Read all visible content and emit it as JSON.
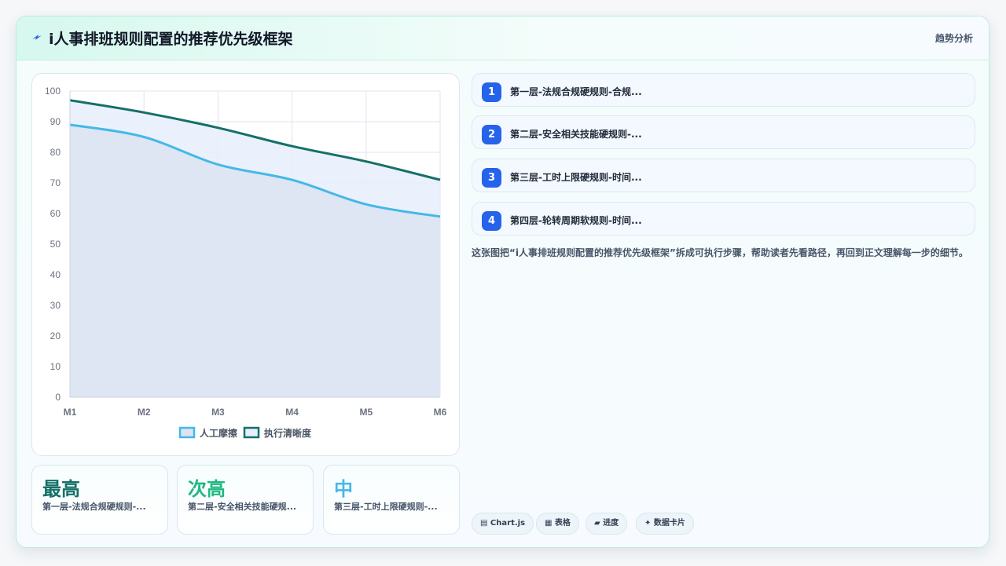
{
  "header": {
    "icon": "lightning-icon",
    "title": "i人事排班规则配置的推荐优先级框架",
    "right_label": "趋势分析"
  },
  "chart_data": {
    "type": "area",
    "title": "",
    "xlabel": "",
    "ylabel": "",
    "categories": [
      "M1",
      "M2",
      "M3",
      "M4",
      "M5",
      "M6"
    ],
    "ylim": [
      0,
      100
    ],
    "yticks": [
      0,
      10,
      20,
      30,
      40,
      50,
      60,
      70,
      80,
      90,
      100
    ],
    "grid": true,
    "legend_position": "bottom",
    "series": [
      {
        "name": "人工摩擦",
        "values": [
          89,
          85,
          76,
          71,
          63,
          59
        ],
        "color": "#44b8e8",
        "fill": "#dbe4f0"
      },
      {
        "name": "执行清晰度",
        "values": [
          97,
          93,
          88,
          82,
          77,
          71
        ],
        "color": "#157068",
        "fill": "#e7effc"
      }
    ]
  },
  "kpis": [
    {
      "value": "最高",
      "label": "第一层-法规合规硬规则-...",
      "color": "#157068"
    },
    {
      "value": "次高",
      "label": "第二层-安全相关技能硬规...",
      "color": "#1fb882"
    },
    {
      "value": "中",
      "label": "第三层-工时上限硬规则-...",
      "color": "#44b8e8"
    }
  ],
  "steps": [
    {
      "num": "1",
      "text": "第一层-法规合规硬规则-合规..."
    },
    {
      "num": "2",
      "text": "第二层-安全相关技能硬规则-..."
    },
    {
      "num": "3",
      "text": "第三层-工时上限硬规则-时间..."
    },
    {
      "num": "4",
      "text": "第四层-轮转周期软规则-时间..."
    }
  ],
  "description": "这张图把“i人事排班规则配置的推荐优先级框架”拆成可执行步骤，帮助读者先看路径，再回到正文理解每一步的细节。",
  "tags": [
    {
      "icon": "chart-icon",
      "label": "▤ Chart.js"
    },
    {
      "icon": "table-icon",
      "label": "▦ 表格"
    },
    {
      "icon": "progress-icon",
      "label": "▰ 进度"
    },
    {
      "icon": "sparkle-icon",
      "label": "✦ 数据卡片"
    }
  ]
}
